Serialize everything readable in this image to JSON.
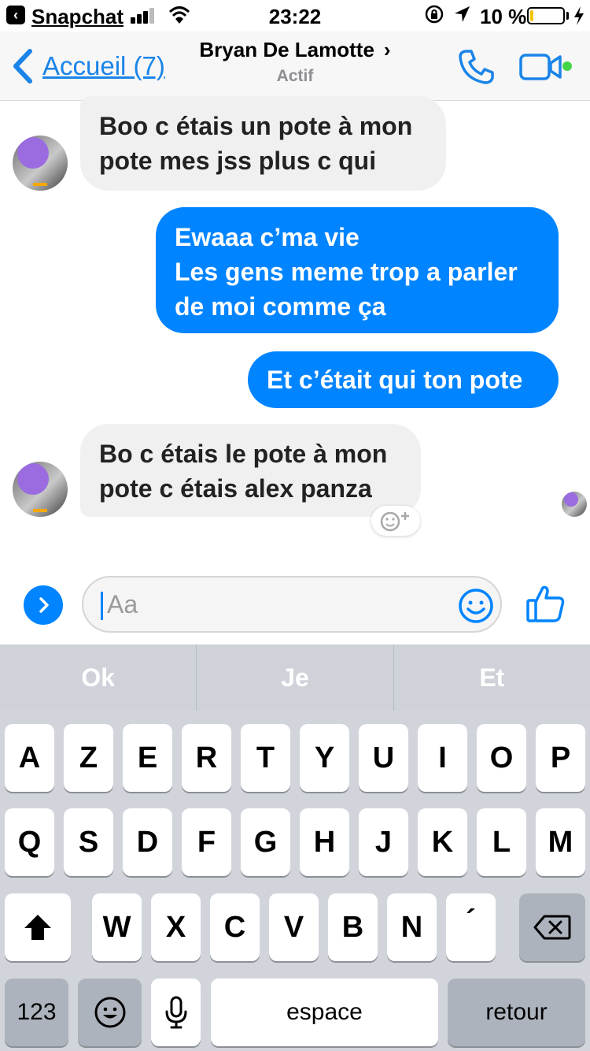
{
  "status_bar": {
    "back_app": "Snapchat",
    "time": "23:22",
    "battery": "10 %",
    "battery_level": 0.1
  },
  "nav": {
    "back_label": "Accueil (7)",
    "contact_name": "Bryan De Lamotte",
    "contact_status": "Actif"
  },
  "messages": [
    {
      "from": "them",
      "text": [
        "Boo c étais un pote à mon",
        "pote mes jss plus c qui"
      ]
    },
    {
      "from": "me",
      "text": [
        "Ewaaa c’ma vie",
        "Les gens meme trop a parler",
        "de moi comme ça"
      ]
    },
    {
      "from": "me",
      "text": [
        "Et c’était qui ton pote"
      ]
    },
    {
      "from": "them",
      "text": [
        "Bo c étais le pote à mon",
        "pote c étais alex panza"
      ]
    }
  ],
  "composer": {
    "placeholder": "Aa"
  },
  "suggestions": [
    "Ok",
    "Je",
    "Et"
  ],
  "keyboard": {
    "row1": [
      "A",
      "Z",
      "E",
      "R",
      "T",
      "Y",
      "U",
      "I",
      "O",
      "P"
    ],
    "row2": [
      "Q",
      "S",
      "D",
      "F",
      "G",
      "H",
      "J",
      "K",
      "L",
      "M"
    ],
    "row3": [
      "W",
      "X",
      "C",
      "V",
      "B",
      "N",
      "´"
    ],
    "numbers_label": "123",
    "space_label": "espace",
    "return_label": "retour"
  },
  "colors": {
    "accent": "#0084ff",
    "ios_blue": "#1a84e8",
    "incoming_bubble": "#f1f0f0",
    "keyboard_bg": "#d1d5db",
    "online": "#44d44a"
  }
}
